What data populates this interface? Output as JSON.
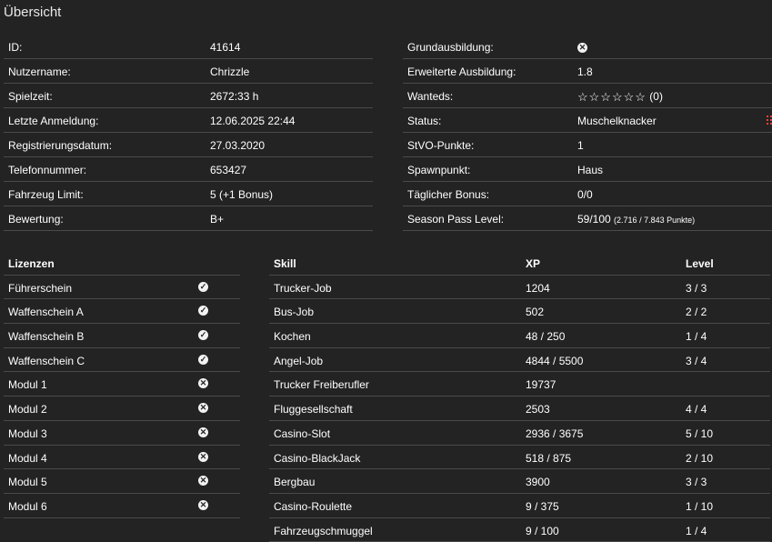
{
  "title": "Übersicht",
  "left": [
    {
      "label": "ID:",
      "value": "41614"
    },
    {
      "label": "Nutzername:",
      "value": "Chrizzle"
    },
    {
      "label": "Spielzeit:",
      "value": "2672:33 h"
    },
    {
      "label": "Letzte Anmeldung:",
      "value": "12.06.2025 22:44"
    },
    {
      "label": "Registrierungsdatum:",
      "value": "27.03.2020"
    },
    {
      "label": "Telefonnummer:",
      "value": "653427"
    },
    {
      "label": "Fahrzeug Limit:",
      "value": "5 (+1 Bonus)"
    },
    {
      "label": "Bewertung:",
      "value": "B+"
    }
  ],
  "right": {
    "grundausbildung": {
      "label": "Grundausbildung:",
      "icon": "x-circle-icon"
    },
    "erweiterte": {
      "label": "Erweiterte Ausbildung:",
      "value": "1.8"
    },
    "wanteds": {
      "label": "Wanteds:",
      "stars": "☆☆☆☆☆☆",
      "count": "(0)"
    },
    "status": {
      "label": "Status:",
      "value": "Muschelknacker",
      "icon": "list-icon"
    },
    "stvo": {
      "label": "StVO-Punkte:",
      "value": "1"
    },
    "spawn": {
      "label": "Spawnpunkt:",
      "value": "Haus"
    },
    "bonus": {
      "label": "Täglicher Bonus:",
      "value": "0/0"
    },
    "season": {
      "label": "Season Pass Level:",
      "value": "59/100",
      "detail": "(2.716 / 7.843 Punkte)"
    }
  },
  "licenses": {
    "header": "Lizenzen",
    "items": [
      {
        "name": "Führerschein",
        "owned": true
      },
      {
        "name": "Waffenschein A",
        "owned": true
      },
      {
        "name": "Waffenschein B",
        "owned": true
      },
      {
        "name": "Waffenschein C",
        "owned": true
      },
      {
        "name": "Modul 1",
        "owned": false
      },
      {
        "name": "Modul 2",
        "owned": false
      },
      {
        "name": "Modul 3",
        "owned": false
      },
      {
        "name": "Modul 4",
        "owned": false
      },
      {
        "name": "Modul 5",
        "owned": false
      },
      {
        "name": "Modul 6",
        "owned": false
      }
    ]
  },
  "skills": {
    "headers": {
      "skill": "Skill",
      "xp": "XP",
      "level": "Level"
    },
    "rows": [
      {
        "skill": "Trucker-Job",
        "xp": "1204",
        "level": "3 / 3"
      },
      {
        "skill": "Bus-Job",
        "xp": "502",
        "level": "2 / 2"
      },
      {
        "skill": "Kochen",
        "xp": "48 / 250",
        "level": "1 / 4"
      },
      {
        "skill": "Angel-Job",
        "xp": "4844 / 5500",
        "level": "3 / 4"
      },
      {
        "skill": "Trucker Freiberufler",
        "xp": "19737",
        "level": ""
      },
      {
        "skill": "Fluggesellschaft",
        "xp": "2503",
        "level": "4 / 4"
      },
      {
        "skill": "Casino-Slot",
        "xp": "2936 / 3675",
        "level": "5 / 10"
      },
      {
        "skill": "Casino-BlackJack",
        "xp": "518 / 875",
        "level": "2 / 10"
      },
      {
        "skill": "Bergbau",
        "xp": "3900",
        "level": "3 / 3"
      },
      {
        "skill": "Casino-Roulette",
        "xp": "9 / 375",
        "level": "1 / 10"
      },
      {
        "skill": "Fahrzeugschmuggel",
        "xp": "9 / 100",
        "level": "1 / 4"
      }
    ]
  }
}
